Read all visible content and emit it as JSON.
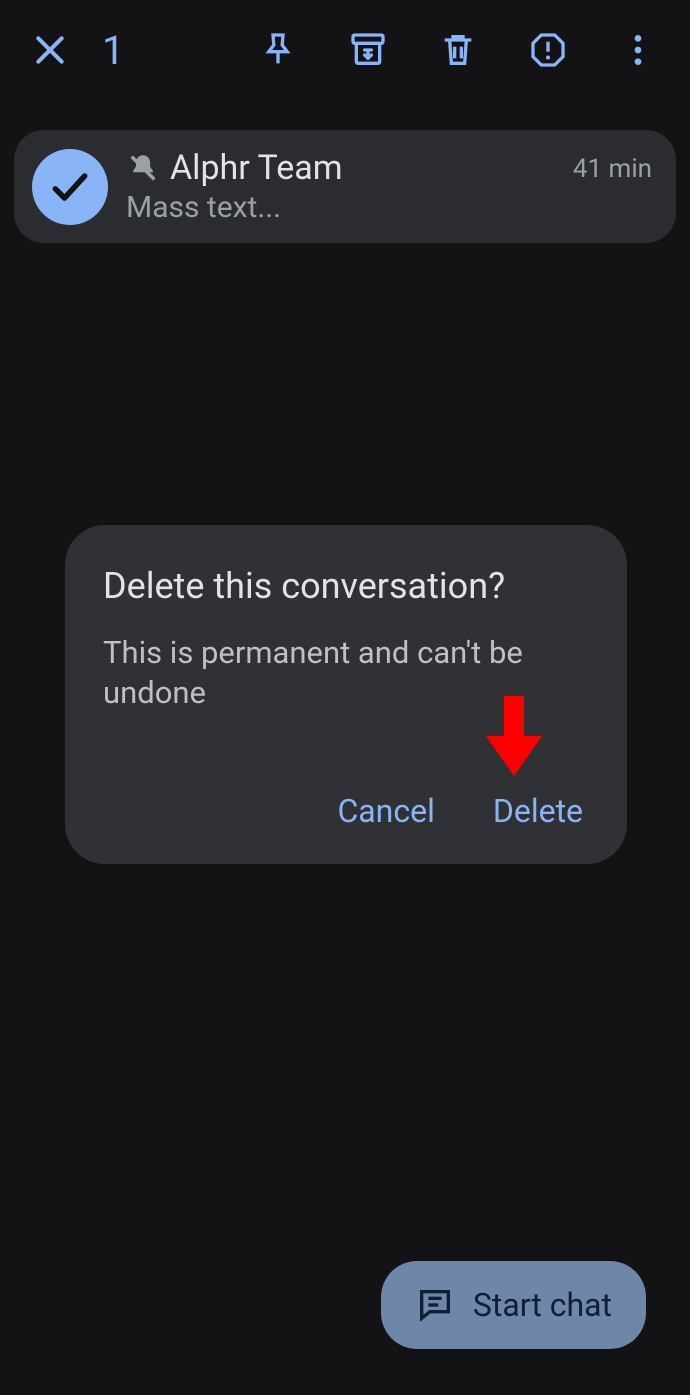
{
  "topbar": {
    "selection_count": "1"
  },
  "conversation": {
    "title": "Alphr Team",
    "preview": "Mass text...",
    "time": "41 min"
  },
  "dialog": {
    "title": "Delete this conversation?",
    "body": "This is permanent and can't be undone",
    "cancel_label": "Cancel",
    "confirm_label": "Delete"
  },
  "fab": {
    "label": "Start chat"
  },
  "colors": {
    "accent": "#8ab4f8",
    "background": "#131316",
    "surface": "#303134",
    "row": "#2a2c30",
    "fab": "#6e86a8"
  }
}
